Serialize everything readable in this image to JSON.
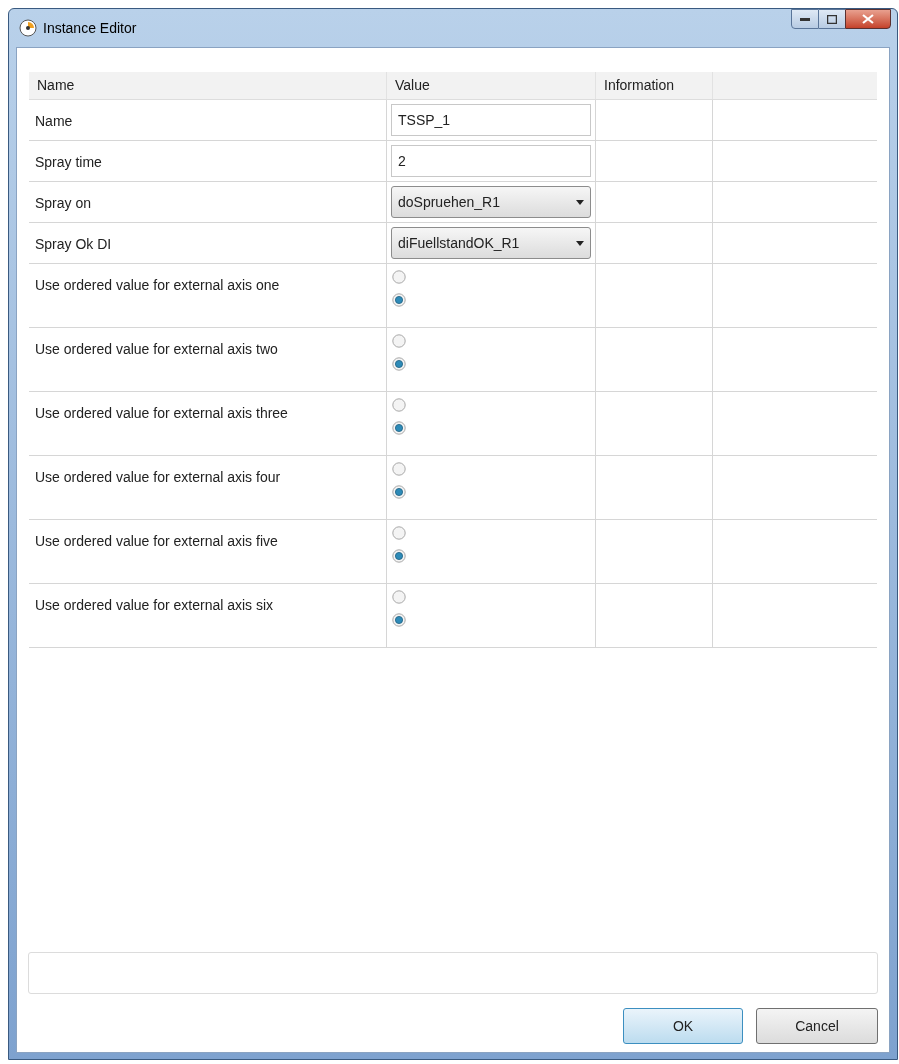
{
  "window": {
    "title": "Instance Editor"
  },
  "table": {
    "columns": [
      "Name",
      "Value",
      "Information"
    ],
    "rows": [
      {
        "name": "Name",
        "kind": "text",
        "value": "TSSP_1"
      },
      {
        "name": "Spray time",
        "kind": "text",
        "value": "2"
      },
      {
        "name": "Spray on",
        "kind": "dropdown",
        "value": "doSpruehen_R1"
      },
      {
        "name": "Spray Ok DI",
        "kind": "dropdown",
        "value": "diFuellstandOK_R1"
      },
      {
        "name": "Use ordered value for external axis one",
        "kind": "radio",
        "options": [
          {
            "selected": false
          },
          {
            "selected": true
          }
        ]
      },
      {
        "name": "Use ordered value for external axis two",
        "kind": "radio",
        "options": [
          {
            "selected": false
          },
          {
            "selected": true
          }
        ]
      },
      {
        "name": "Use ordered value for external axis three",
        "kind": "radio",
        "options": [
          {
            "selected": false
          },
          {
            "selected": true
          }
        ]
      },
      {
        "name": "Use ordered value for external axis four",
        "kind": "radio",
        "options": [
          {
            "selected": false
          },
          {
            "selected": true
          }
        ]
      },
      {
        "name": "Use ordered value for external axis five",
        "kind": "radio",
        "options": [
          {
            "selected": false
          },
          {
            "selected": true
          }
        ]
      },
      {
        "name": "Use ordered value for external axis six",
        "kind": "radio",
        "options": [
          {
            "selected": false
          },
          {
            "selected": true
          }
        ]
      }
    ]
  },
  "buttons": [
    {
      "label": "OK",
      "default": true
    },
    {
      "label": "Cancel",
      "default": false
    }
  ]
}
